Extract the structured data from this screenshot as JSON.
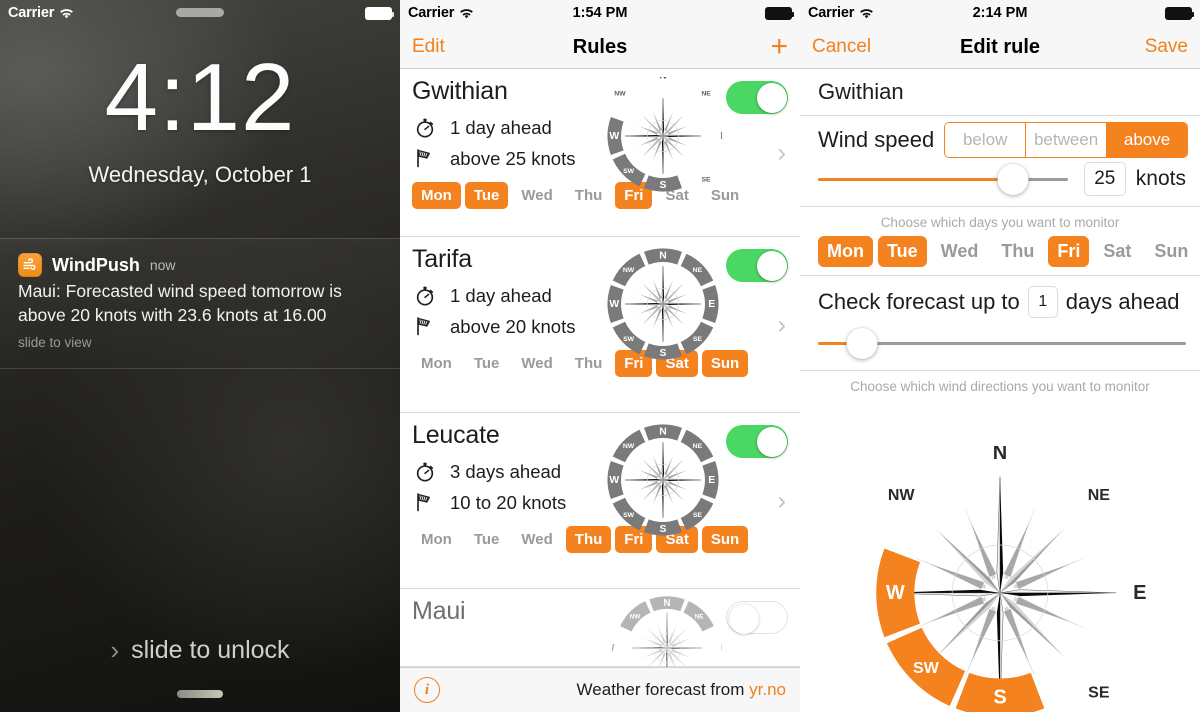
{
  "screens": {
    "lock": {
      "status": {
        "carrier": "Carrier",
        "wifi_icon": "wifi-icon",
        "battery_icon": "battery-icon"
      },
      "time": "4:12",
      "date": "Wednesday, October 1",
      "notification": {
        "app_icon": "windpush-app-icon",
        "app_name": "WindPush",
        "when": "now",
        "body": "Maui: Forecasted wind speed tomorrow is above 20 knots with 23.6 knots at 16.00",
        "hint": "slide to view"
      },
      "slide_to_unlock": "slide to unlock",
      "slide_chevron": "chevron-right-icon"
    },
    "rules": {
      "status": {
        "carrier": "Carrier",
        "time": "1:54 PM",
        "wifi_icon": "wifi-icon",
        "battery_icon": "battery-icon"
      },
      "nav": {
        "left": "Edit",
        "title": "Rules",
        "right_icon": "plus-icon"
      },
      "day_names": [
        "Mon",
        "Tue",
        "Wed",
        "Thu",
        "Fri",
        "Sat",
        "Sun"
      ],
      "cards": [
        {
          "name": "Gwithian",
          "lead_time": "1 day ahead",
          "speed": "above 25 knots",
          "enabled": true,
          "active_days": [
            "Mon",
            "Tue",
            "Fri"
          ],
          "directions": [
            "W",
            "SW",
            "S"
          ],
          "clock_icon": "stopwatch-icon",
          "wind_icon": "wind-flag-icon",
          "chevron_icon": "chevron-right-icon"
        },
        {
          "name": "Tarifa",
          "lead_time": "1 day ahead",
          "speed": "above 20 knots",
          "enabled": true,
          "active_days": [
            "Fri",
            "Sat",
            "Sun"
          ],
          "directions": [
            "N",
            "NE",
            "E",
            "SE",
            "S",
            "SW",
            "W",
            "NW"
          ],
          "clock_icon": "stopwatch-icon",
          "wind_icon": "wind-flag-icon",
          "chevron_icon": "chevron-right-icon"
        },
        {
          "name": "Leucate",
          "lead_time": "3 days ahead",
          "speed": "10 to 20 knots",
          "enabled": true,
          "active_days": [
            "Thu",
            "Fri",
            "Sat",
            "Sun"
          ],
          "directions": [
            "N",
            "NE",
            "E",
            "SE",
            "S",
            "SW",
            "W",
            "NW"
          ],
          "clock_icon": "stopwatch-icon",
          "wind_icon": "wind-flag-icon",
          "chevron_icon": "chevron-right-icon"
        },
        {
          "name": "Maui",
          "lead_time": "",
          "speed": "",
          "enabled": false,
          "active_days": [],
          "directions": [
            "NW",
            "N",
            "NE"
          ],
          "clock_icon": "stopwatch-icon",
          "wind_icon": "wind-flag-icon",
          "chevron_icon": "chevron-right-icon"
        }
      ],
      "footer": {
        "info_icon": "info-icon",
        "text": "Weather forecast from ",
        "link": "yr.no"
      }
    },
    "edit": {
      "status": {
        "carrier": "Carrier",
        "time": "2:14 PM",
        "wifi_icon": "wifi-icon",
        "battery_icon": "battery-icon"
      },
      "nav": {
        "left": "Cancel",
        "title": "Edit rule",
        "right": "Save"
      },
      "location": "Gwithian",
      "wind_speed": {
        "label": "Wind speed",
        "options": [
          "below",
          "between",
          "above"
        ],
        "selected": "above",
        "value": "25",
        "unit": "knots",
        "slider_percent": 78
      },
      "days_hint": "Choose which days you want to monitor",
      "day_names": [
        "Mon",
        "Tue",
        "Wed",
        "Thu",
        "Fri",
        "Sat",
        "Sun"
      ],
      "active_days": [
        "Mon",
        "Tue",
        "Fri"
      ],
      "forecast": {
        "prefix": "Check forecast up to",
        "value": "1",
        "suffix": "days ahead",
        "slider_percent": 12
      },
      "directions_hint": "Choose which wind directions you want to monitor",
      "direction_labels": [
        "N",
        "NE",
        "E",
        "SE",
        "S",
        "SW",
        "W",
        "NW"
      ],
      "active_directions": [
        "W",
        "SW",
        "S"
      ]
    }
  },
  "colors": {
    "accent_orange": "#f4821f",
    "nav_orange": "#f0821e",
    "toggle_green": "#4bd763",
    "compass_gray": "#7a7a7a",
    "inactive_gray": "#9a9a9a"
  }
}
